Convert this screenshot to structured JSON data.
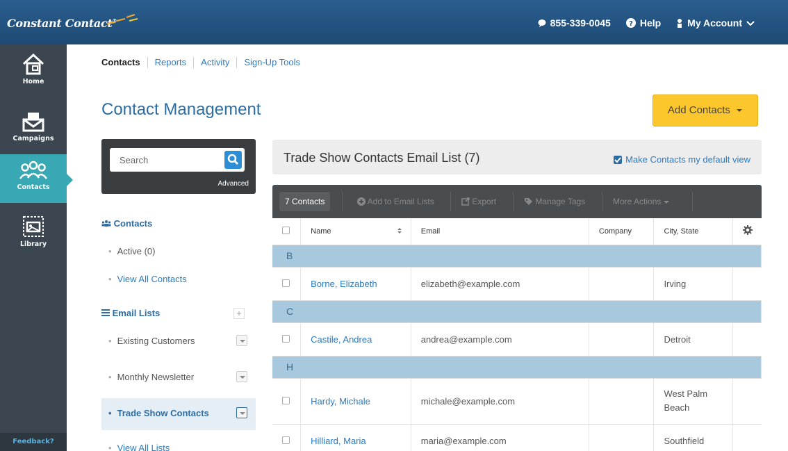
{
  "header": {
    "logo_text": "Constant Contact",
    "logo_tm": "®",
    "phone": "855-339-0045",
    "help": "Help",
    "account": "My Account"
  },
  "rail": {
    "items": [
      {
        "label": "Home",
        "icon": "home-icon"
      },
      {
        "label": "Campaigns",
        "icon": "campaigns-icon"
      },
      {
        "label": "Contacts",
        "icon": "contacts-icon",
        "active": true
      },
      {
        "label": "Library",
        "icon": "library-icon"
      }
    ],
    "feedback": "Feedback?"
  },
  "subnav": [
    "Contacts",
    "Reports",
    "Activity",
    "Sign-Up Tools"
  ],
  "page": {
    "title": "Contact Management",
    "add_contacts": "Add Contacts"
  },
  "search": {
    "placeholder": "Search",
    "advanced": "Advanced"
  },
  "left": {
    "contacts_head": "Contacts",
    "active": "Active (0)",
    "view_all_contacts": "View All Contacts",
    "email_lists_head": "Email Lists",
    "lists": [
      "Existing Customers",
      "Monthly Newsletter",
      "Trade Show Contacts"
    ],
    "view_all_lists": "View All Lists"
  },
  "main": {
    "list_title": "Trade Show Contacts Email List (7)",
    "default_view": "Make Contacts my default view",
    "toolbar": {
      "count": "7 Contacts",
      "add_to_lists": "Add to Email Lists",
      "export": "Export",
      "manage_tags": "Manage Tags",
      "more_actions": "More Actions"
    },
    "columns": [
      "Name",
      "Email",
      "Company",
      "City, State"
    ],
    "groups": [
      {
        "letter": "B",
        "rows": [
          {
            "name": "Borne, Elizabeth",
            "email": "elizabeth@example.com",
            "company": "",
            "city": "Irving"
          }
        ]
      },
      {
        "letter": "C",
        "rows": [
          {
            "name": "Castile, Andrea",
            "email": "andrea@example.com",
            "company": "",
            "city": "Detroit"
          }
        ]
      },
      {
        "letter": "H",
        "rows": [
          {
            "name": "Hardy, Michale",
            "email": "michale@example.com",
            "company": "",
            "city": "West Palm Beach"
          },
          {
            "name": "Hilliard, Maria",
            "email": "maria@example.com",
            "company": "",
            "city": "Southfield"
          }
        ]
      }
    ]
  },
  "colors": {
    "header_bg": "#1f4e79",
    "rail_bg": "#3b4650",
    "active_teal": "#38a9b4",
    "accent_yellow": "#fcc62d",
    "link_blue": "#2c7bbf",
    "group_row": "#a8c8dd"
  }
}
